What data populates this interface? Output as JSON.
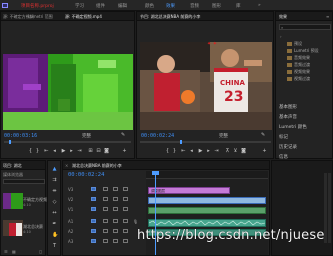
{
  "app": {
    "project_title": "项目名称.prproj",
    "workspaces": [
      "学习",
      "组件",
      "编辑",
      "颜色",
      "效果",
      "音频",
      "图形",
      "库"
    ],
    "active_workspace_index": 4
  },
  "source_monitor": {
    "tabs": [
      "源: 不確定方視頻",
      "Lumetri 范围",
      "源: 不确定视频.mp4"
    ],
    "timecode": "00:00:03:16",
    "zoom": "完整"
  },
  "program_monitor": {
    "title": "节目: 湖北总决赛NBA 前赛的小李",
    "timecode": "00:00:02:24",
    "zoom": "完整",
    "overlay_text": "CHINA",
    "jersey_number": "23"
  },
  "project_panel": {
    "tabs": [
      "项目: 湖北",
      "媒体浏览器"
    ],
    "search_placeholder": "",
    "items": [
      {
        "name": "不确定方视频",
        "duration": "4:10"
      },
      {
        "name": "湖北总决赛",
        "duration": "4:10"
      }
    ]
  },
  "timeline": {
    "title": "湖北总决赛NBA 前赛的小李",
    "timecode": "00:00:02:24",
    "video_tracks": [
      "V3",
      "V2",
      "V1"
    ],
    "audio_tracks": [
      "A1",
      "A2",
      "A3"
    ],
    "clip_label": "调整图层",
    "colors": {
      "video_clip": "#c47ad6",
      "audio_clip": "#47a58e",
      "playhead": "#4d9cff"
    }
  },
  "effects_panel": {
    "title": "效果",
    "search_placeholder": "",
    "tree": [
      "预设",
      "Lumetri 预设",
      "音频效果",
      "音频过渡",
      "视频效果",
      "视频过渡"
    ],
    "sections": [
      "基本图形",
      "基本声音",
      "Lumetri 颜色",
      "标记",
      "历史记录",
      "信息"
    ]
  },
  "watermark": "https://blog.csdn.net/njuese"
}
